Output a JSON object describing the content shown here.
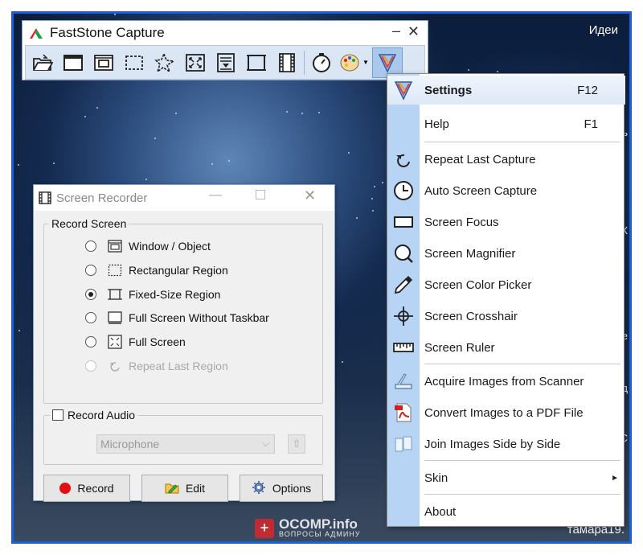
{
  "desktop": {
    "top_right_text": "Идеи",
    "username": "тамара19.",
    "edge_glyphs": [
      "ть",
      "ГХ",
      "е",
      "д",
      "С"
    ],
    "watermark": {
      "name": "OCOMP.info",
      "tagline": "ВОПРОСЫ АДМИНУ"
    }
  },
  "faststone": {
    "title": "FastStone Capture",
    "controls": {
      "minimize": "–",
      "close": "✕"
    },
    "toolbar": [
      "open-folder-icon",
      "capture-window-icon",
      "capture-object-icon",
      "capture-rect-icon",
      "capture-freehand-icon",
      "capture-fullscreen-icon",
      "capture-scrolling-icon",
      "capture-fixed-icon",
      "screen-recorder-icon",
      "timer-icon",
      "output-palette-icon",
      "settings-icon"
    ]
  },
  "menu": {
    "items": [
      {
        "label": "Settings",
        "shortcut": "F12",
        "icon": "settings-icon"
      },
      {
        "label": "Help",
        "shortcut": "F1",
        "icon": ""
      },
      {
        "label": "Repeat Last Capture",
        "icon": "repeat-icon"
      },
      {
        "label": "Auto Screen Capture",
        "icon": "clock-icon"
      },
      {
        "label": "Screen Focus",
        "icon": "focus-icon"
      },
      {
        "label": "Screen Magnifier",
        "icon": "magnifier-icon"
      },
      {
        "label": "Screen Color Picker",
        "icon": "eyedropper-icon"
      },
      {
        "label": "Screen Crosshair",
        "icon": "crosshair-icon"
      },
      {
        "label": "Screen Ruler",
        "icon": "ruler-icon"
      },
      {
        "label": "Acquire Images from Scanner",
        "icon": "scanner-icon"
      },
      {
        "label": "Convert Images to a PDF File",
        "icon": "pdf-icon"
      },
      {
        "label": "Join Images Side by Side",
        "icon": "join-images-icon"
      },
      {
        "label": "Skin",
        "submenu_arrow": "►",
        "icon": ""
      },
      {
        "label": "About",
        "icon": ""
      }
    ]
  },
  "recorder": {
    "title": "Screen Recorder",
    "controls": {
      "minimize": "—",
      "close": "✕"
    },
    "record_screen_label": "Record Screen",
    "options": [
      {
        "label": "Window / Object",
        "checked": false,
        "disabled": false,
        "icon": "window-object-icon"
      },
      {
        "label": "Rectangular Region",
        "checked": false,
        "disabled": false,
        "icon": "rect-region-icon"
      },
      {
        "label": "Fixed-Size Region",
        "checked": true,
        "disabled": false,
        "icon": "fixed-region-icon"
      },
      {
        "label": "Full Screen Without Taskbar",
        "checked": false,
        "disabled": false,
        "icon": "fullscreen-no-taskbar-icon"
      },
      {
        "label": "Full Screen",
        "checked": false,
        "disabled": false,
        "icon": "fullscreen-icon"
      },
      {
        "label": "Repeat Last Region",
        "checked": false,
        "disabled": true,
        "icon": "repeat-region-icon"
      }
    ],
    "record_audio_label": "Record Audio",
    "record_audio_checked": false,
    "microphone_value": "Microphone",
    "buttons": {
      "record": "Record",
      "edit": "Edit",
      "options": "Options"
    }
  }
}
